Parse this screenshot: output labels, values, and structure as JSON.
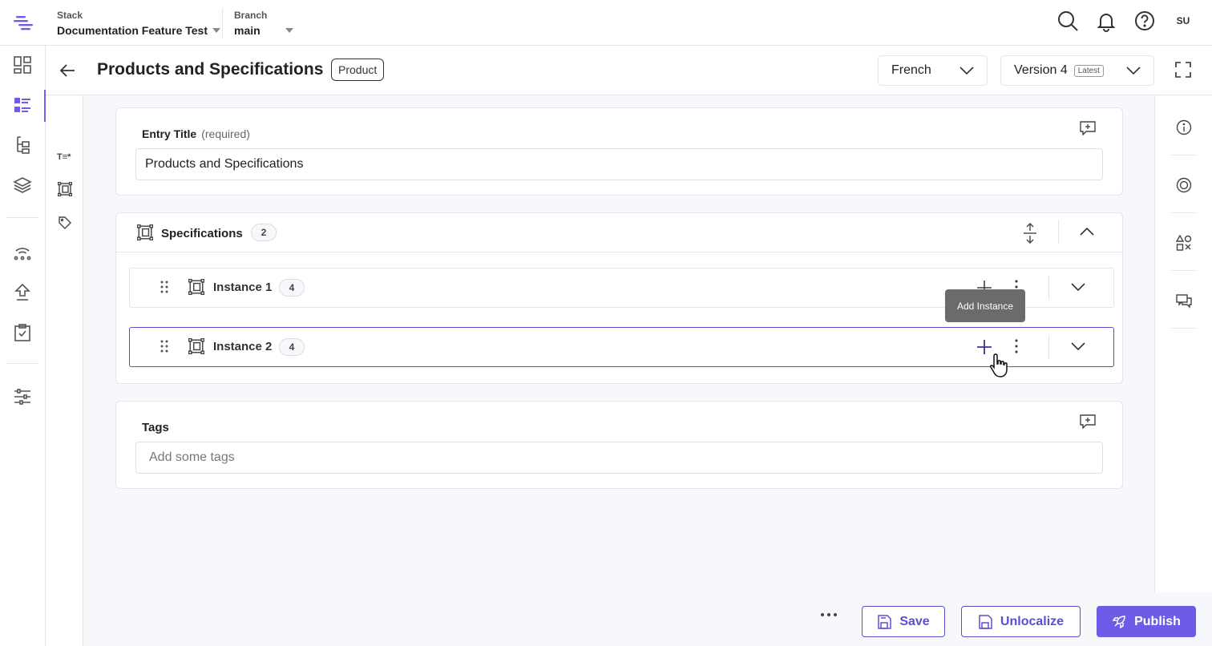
{
  "topbar": {
    "stack_label": "Stack",
    "stack_value": "Documentation Feature Test",
    "branch_label": "Branch",
    "branch_value": "main",
    "avatar_initials": "SU",
    "icons": [
      "search-icon",
      "bell-icon",
      "help-icon"
    ]
  },
  "leftnav": {
    "icons": [
      "dashboard-icon",
      "entries-icon",
      "content-models-icon",
      "assets-icon",
      "releases-icon",
      "deploy-icon",
      "tasks-icon",
      "settings-icon"
    ],
    "active": "entries-icon"
  },
  "entry_header": {
    "title": "Products and Specifications",
    "content_type": "Product",
    "language": "French",
    "version": "Version 4",
    "version_tag": "Latest"
  },
  "fields": {
    "entry_title": {
      "label": "Entry Title",
      "qualifier": "(required)",
      "value": "Products and Specifications"
    },
    "specifications": {
      "label": "Specifications",
      "count": "2",
      "instances": [
        {
          "name": "Instance 1",
          "count": "4"
        },
        {
          "name": "Instance 2",
          "count": "4"
        }
      ]
    },
    "tags": {
      "label": "Tags",
      "placeholder": "Add some tags"
    }
  },
  "tooltip": "Add Instance",
  "actions": {
    "save": "Save",
    "unlocalize": "Unlocalize",
    "publish": "Publish"
  },
  "colors": {
    "accent": "#6c5ce7",
    "border": "#e3e5ec",
    "tooltip_bg": "#6b6b6b"
  }
}
